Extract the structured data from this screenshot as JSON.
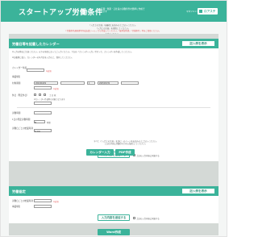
{
  "header": {
    "title": "スタートアップ労働条件",
    "subtitle": "有期・無期・正社員の労働条件を簡単に作成できます",
    "brand_small": "マネジメント",
    "logo": "ロアステ"
  },
  "intro": {
    "line1": "「入力上の注意」を最初にお読みの上ご記入ください。",
    "line2": "「入力上の注意」を参照してください。",
    "line3": "「労働条件通知書等作成支援ツール」から作成してください。「雇用契約書」「労働条件」等をご参照ください。",
    "line4": "お読みください。"
  },
  "section1": {
    "title": "労働日等を記載したカレンダー",
    "example_button": "記入例を表示",
    "note1": "※入力の際はご注意ください。以下の項目に沿ってご入力ください。下記の「カレンダー入力」ボタンで、カレンダーを作成してください。",
    "note2": "※記載例に従い、カレンダーの年月日を入力の上、保存してください。",
    "fields": [
      {
        "label": "カレンダー年度",
        "value": ""
      },
      {
        "label": "事業場名",
        "value": ""
      },
      {
        "label": "対象期間",
        "value": "2024/04/01",
        "value2": "1",
        "value3": "2025/03/31"
      },
      {
        "label": "休日（所定休日）",
        "value": "土 日 祝",
        "hint": "※カレンダー作成時の対象となります"
      },
      {
        "label": "労働時間",
        "value": ""
      },
      {
        "label": "1日の所定労働時間",
        "value": "8",
        "unit": "時間"
      },
      {
        "label": "労働日ごとの始業時刻",
        "value": "9:00"
      }
    ],
    "required": "※必須",
    "agree_text": "上記の入力内容に同意する",
    "confirm_button": "入力内容を送信する",
    "foot1": "すべて（「入力上の注意」を含む）のページをお読みの上ご記入ください。",
    "foot2": "上記の内容に問題がなければ送信してください。"
  },
  "tabs": {
    "calendar": "カレンダー入力",
    "pdf": "PDF作成"
  },
  "section2": {
    "title": "労働協定",
    "example_button": "記入例を表示",
    "fields": [
      {
        "label": "労働日ごとの始業時刻",
        "value": ""
      },
      {
        "label": "事業場名",
        "value": ""
      }
    ],
    "required": "※必須",
    "agree_text": "上記の入力内容に同意する",
    "confirm_button": "入力内容を送信する"
  },
  "word_button": "Word作成",
  "colors": {
    "accent": "#3bb39a",
    "panel": "#d4d9d6",
    "required": "#e25a5a"
  }
}
